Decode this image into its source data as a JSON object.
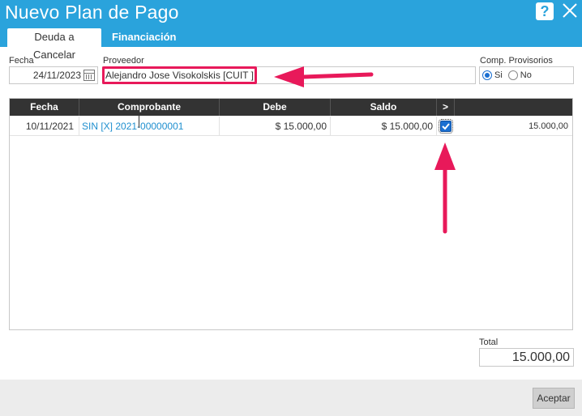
{
  "window": {
    "title": "Nuevo Plan de Pago",
    "help_label": "?"
  },
  "tabs": [
    {
      "label": "Deuda a Cancelar",
      "active": true
    },
    {
      "label": "Financiación",
      "active": false
    }
  ],
  "form": {
    "fecha_label": "Fecha",
    "fecha_value": "24/11/2023",
    "proveedor_label": "Proveedor",
    "proveedor_value": "Alejandro Jose Visokolskis [CUIT ]",
    "comp_label": "Comp. Provisorios",
    "comp_options": [
      {
        "label": "Si",
        "selected": true
      },
      {
        "label": "No",
        "selected": false
      }
    ]
  },
  "grid": {
    "columns": [
      "Fecha",
      "Comprobante",
      "Debe",
      "Saldo",
      ">"
    ],
    "rows": [
      {
        "fecha": "10/11/2021",
        "comprobante": "SIN [X] 2021-00000001",
        "debe": "$ 15.000,00",
        "saldo": "$ 15.000,00",
        "checked": true,
        "importe": "15.000,00"
      }
    ]
  },
  "total": {
    "label": "Total",
    "value": "15.000,00"
  },
  "footer": {
    "accept_label": "Aceptar"
  },
  "colors": {
    "titlebar": "#2aa3dc",
    "annotation": "#e8195a",
    "header_bg": "#333333",
    "link": "#1f8fcf"
  },
  "icons": [
    "help-icon",
    "close-icon",
    "calendar-icon",
    "checkbox-icon",
    "annotation-arrow-icon"
  ]
}
